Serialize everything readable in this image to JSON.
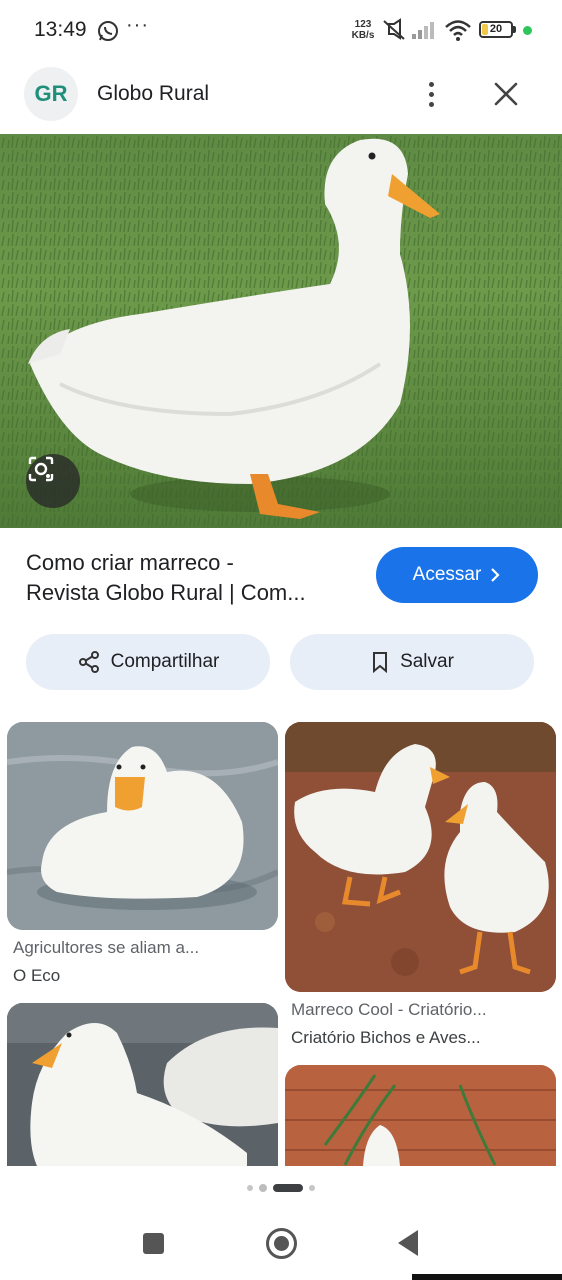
{
  "status_bar": {
    "time": "13:49",
    "more": "···",
    "speed_value": "123",
    "speed_unit": "KB/s",
    "battery_level": "20",
    "battery_fraction": 0.2
  },
  "header": {
    "logo_text": "GR",
    "site_name": "Globo Rural"
  },
  "result": {
    "title_line1": "Como criar marreco -",
    "title_line2": "Revista Globo Rural | Com...",
    "visit_label": "Acessar",
    "share_label": "Compartilhar",
    "save_label": "Salvar"
  },
  "related": [
    {
      "title": "Agricultores se aliam a...",
      "source": "O Eco"
    },
    {
      "title": "Marreco Cool - Criatório...",
      "source": "Criatório Bichos e Aves..."
    }
  ],
  "colors": {
    "accent": "#1a73e8",
    "action_bg": "#e8eef8",
    "grass": "#5f8a44"
  },
  "icons": [
    "whatsapp-icon",
    "mute-icon",
    "signal-icon",
    "wifi-icon",
    "battery-icon",
    "more-vert-icon",
    "close-icon",
    "lens-icon",
    "share-icon",
    "bookmark-icon",
    "chevron-right-icon"
  ]
}
